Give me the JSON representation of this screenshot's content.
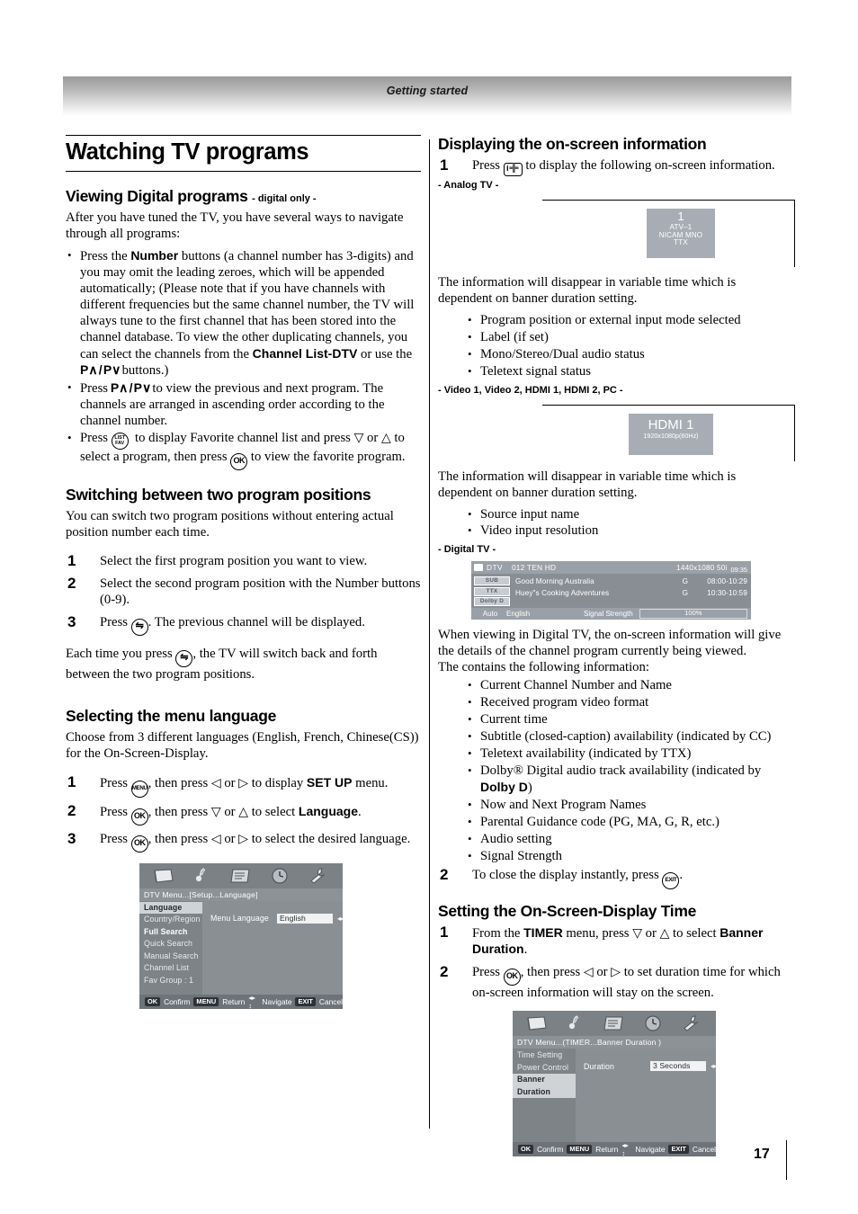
{
  "header": {
    "title": "Getting started"
  },
  "folio": {
    "page": "17"
  },
  "left": {
    "chapter_title": "Watching TV programs",
    "sec1": {
      "title": "Viewing Digital programs",
      "suffix": "- digital only -",
      "intro": "After you have tuned the TV, you have several ways to navigate through all programs:",
      "bullets": [
        "Press the Number buttons (a channel number has 3-digits) and you may omit the leading zeroes, which will be appended automatically; (Please note that if you have channels with different frequencies but the same channel number, the TV will always tune to the first channel that has been stored into the channel database. To view the other duplicating channels, you can select the channels from the Channel List-DTV or use the P∧/P∨ buttons.)",
        "Press P∧/P∨ to view the previous and next program. The channels are arranged in ascending order according to the channel number.",
        "Press (LIST FAV) to display Favorite channel list and press ▽ or △ to select a program, then press OK to view the favorite program."
      ]
    },
    "sec2": {
      "title": "Switching between two program positions",
      "intro": "You can switch two program positions without entering actual position number each time.",
      "steps": [
        {
          "n": "1",
          "text": "Select the first program position you want to view."
        },
        {
          "n": "2",
          "text": "Select the second program position with the Number buttons (0-9)."
        },
        {
          "n": "3",
          "text": "Press (swap). The previous channel will be displayed."
        }
      ],
      "note": "Each time you press (swap), the TV will switch back and forth between the two program positions."
    },
    "sec3": {
      "title": "Selecting the menu language",
      "intro": "Choose from 3 different languages (English, French, Chinese(CS)) for the On-Screen-Display.",
      "steps": [
        {
          "n": "1",
          "text": "Press (MENU), then press ◁ or ▷ to display SET UP menu.",
          "bold": "SET UP"
        },
        {
          "n": "2",
          "text": "Press (OK), then press ▽ or △ to select Language.",
          "bold": "Language"
        },
        {
          "n": "3",
          "text": "Press (OK), then press ◁ or ▷ to select the desired language."
        }
      ]
    },
    "osd": {
      "path": "DTV Menu...[Setup...Language]",
      "items": [
        {
          "label": "Language",
          "state": "selected"
        },
        {
          "label": "Country/Region",
          "state": "normal"
        },
        {
          "label": "Full Search",
          "state": "bold"
        },
        {
          "label": "Quick Search",
          "state": "normal"
        },
        {
          "label": "Manual Search",
          "state": "normal"
        },
        {
          "label": "Channel List",
          "state": "normal"
        },
        {
          "label": "Fav Group : 1",
          "state": "normal"
        }
      ],
      "field_label": "Menu Language",
      "field_value": "English",
      "footer": [
        {
          "chip": "OK",
          "label": "Confirm"
        },
        {
          "chip": "MENU",
          "label": "Return"
        },
        {
          "chip": "◂▸ ↕",
          "label": "Navigate"
        },
        {
          "chip": "EXIT",
          "label": "Cancel"
        }
      ]
    }
  },
  "right": {
    "sec1": {
      "title": "Displaying the on-screen information",
      "step1": {
        "n": "1",
        "text": "Press (i+) to display the following on-screen information."
      },
      "analog_caption": "- Analog TV -",
      "analog_banner": {
        "number": "1",
        "line2": "ATV–1",
        "line3": "NICAM MNO",
        "line4": "TTX"
      },
      "analog_note": "The information will disappear in variable time which is dependent on banner duration setting.",
      "analog_bullets": [
        "Program position or external input mode selected",
        "Label (if set)",
        "Mono/Stereo/Dual audio status",
        "Teletext signal status"
      ],
      "video_caption": "- Video 1, Video 2, HDMI 1, HDMI 2, PC -",
      "hdmi_banner": {
        "title": "HDMI 1",
        "resolution": "1920x1080p(60Hz)"
      },
      "video_note": "The information will disappear in variable time which is dependent on banner duration setting.",
      "video_bullets": [
        "Source input name",
        "Video input resolution"
      ],
      "digital_caption": "- Digital TV -",
      "dtv_banner": {
        "mode": "DTV",
        "channel": "012 TEN HD",
        "resolution": "1440x1080 50i",
        "clock": "09:35",
        "badges": [
          "SUB",
          "TTX",
          "Dolby D"
        ],
        "programs": [
          {
            "name": "Good Morning Australia",
            "rating": "G",
            "time": "08:00-10:29"
          },
          {
            "name": "Huey\"s Cooking Adventures",
            "rating": "G",
            "time": "10:30-10:59"
          }
        ],
        "audio_mode": "Auto",
        "audio_lang": "English",
        "signal_label": "Signal Strength",
        "signal_value": "100%"
      },
      "digital_note": "When viewing in Digital TV, the on-screen information will give the details of the channel program currently being viewed.",
      "digital_note2": "The contains the following information:",
      "digital_bullets": [
        "Current Channel Number and Name",
        "Received program video format",
        "Current time",
        "Subtitle (closed-caption) availability (indicated by CC)",
        "Teletext availability (indicated by TTX)",
        "Dolby® Digital audio track availability (indicated by Dolby D)",
        "Now and Next Program Names",
        "Parental Guidance code (PG, MA, G, R, etc.)",
        "Audio setting",
        "Signal Strength"
      ],
      "step2": {
        "n": "2",
        "text": "To close the display instantly, press (EXIT)."
      }
    },
    "sec2": {
      "title": "Setting the On-Screen-Display Time",
      "steps": [
        {
          "n": "1",
          "text": "From the TIMER menu, press ▽ or △ to select Banner Duration."
        },
        {
          "n": "2",
          "text": "Press (OK), then press ◁ or ▷ to set duration time for which on-screen information will stay on the screen."
        }
      ]
    },
    "osd": {
      "path": "DTV Menu...(TIMER...Banner Duration )",
      "items": [
        {
          "label": "Time Setting",
          "state": "normal"
        },
        {
          "label": "Power Control",
          "state": "normal"
        },
        {
          "label": "Banner Duration",
          "state": "selected"
        }
      ],
      "field_label": "Duration",
      "field_value": "3 Seconds",
      "footer": [
        {
          "chip": "OK",
          "label": "Confirm"
        },
        {
          "chip": "MENU",
          "label": "Return"
        },
        {
          "chip": "◂▸ ↕",
          "label": "Navigate"
        },
        {
          "chip": "EXIT",
          "label": "Cancel"
        }
      ]
    }
  }
}
